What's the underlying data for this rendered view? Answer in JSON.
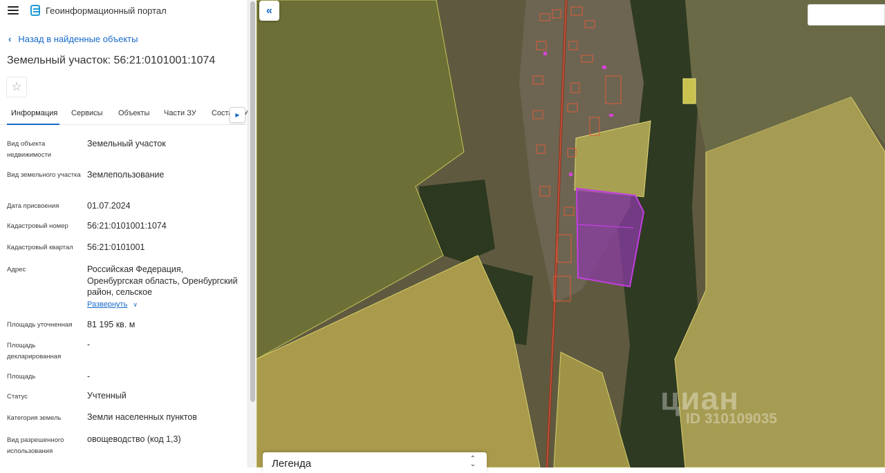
{
  "app": {
    "title": "Геоинформационный портал"
  },
  "nav": {
    "back_label": "Назад в найденные объекты"
  },
  "object": {
    "title": "Земельный участок: 56:21:0101001:1074"
  },
  "tabs": [
    {
      "label": "Информация",
      "active": true
    },
    {
      "label": "Сервисы"
    },
    {
      "label": "Объекты"
    },
    {
      "label": "Части ЗУ"
    },
    {
      "label": "Состав ЗУ"
    }
  ],
  "attributes": [
    {
      "label": "Вид объекта недвижимости",
      "value": "Земельный участок"
    },
    {
      "label": "Вид земельного участка",
      "value": "Землепользование"
    },
    {
      "label": "Дата присвоения",
      "value": "01.07.2024"
    },
    {
      "label": "Кадастровый номер",
      "value": "56:21:0101001:1074"
    },
    {
      "label": "Кадастровый квартал",
      "value": "56:21:0101001"
    },
    {
      "label": "Адрес",
      "value": "Российская Федерация, Оренбургская область, Оренбургский район, сельское"
    },
    {
      "label": "Площадь уточненная",
      "value": "81 195 кв. м"
    },
    {
      "label": "Площадь декларированная",
      "value": "-"
    },
    {
      "label": "Площадь",
      "value": "-"
    },
    {
      "label": "Статус",
      "value": "Учтенный"
    },
    {
      "label": "Категория земель",
      "value": "Земли населенных пунктов"
    },
    {
      "label": "Вид разрешенного использования",
      "value": "овощеводство (код 1,3)"
    }
  ],
  "address_expand": {
    "label": "Развернуть"
  },
  "map": {
    "search_value": "",
    "legend_title": "Легенда",
    "watermark_brand": "циан",
    "watermark_id": "ID 310109035",
    "colors": {
      "parcel_fill": "#d8d05a",
      "parcel_border": "#e8e27a",
      "selected_fill": "#9c2fb8",
      "selected_border": "#c23fe0",
      "building_outline": "#e05a3a",
      "accent": "#1769c9"
    }
  }
}
